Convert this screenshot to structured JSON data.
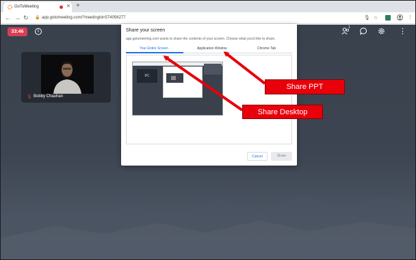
{
  "browser": {
    "tab_title": "GoToMeeting",
    "url": "app.gotomeeting.com/?meetingId=574056277",
    "icons": [
      "back-icon",
      "forward-icon",
      "reload-icon",
      "lock-icon",
      "mic-icon",
      "star-icon",
      "extension-icon",
      "profile-icon",
      "menu-icon"
    ]
  },
  "meeting": {
    "timer": "33:46",
    "participant_count_badge": "1",
    "participant": {
      "name": "Bobby Chauhan"
    }
  },
  "dialog": {
    "title": "Share your screen",
    "subtitle": "app.gotomeeting.com wants to share the contents of your screen. Choose what you'd like to share.",
    "tabs": [
      {
        "label": "Your Entire Screen",
        "active": true
      },
      {
        "label": "Application Window",
        "active": false
      },
      {
        "label": "Chrome Tab",
        "active": false
      }
    ],
    "preview_tile_label": "BC",
    "cancel_label": "Cancel",
    "share_label": "Share"
  },
  "annotations": {
    "share_ppt": "Share PPT",
    "share_desktop": "Share Desktop",
    "color": "#e8000b"
  },
  "colors": {
    "accent_blue": "#1a73e8",
    "timer_red": "#d83e54",
    "meeting_bg": "#3d4552"
  }
}
